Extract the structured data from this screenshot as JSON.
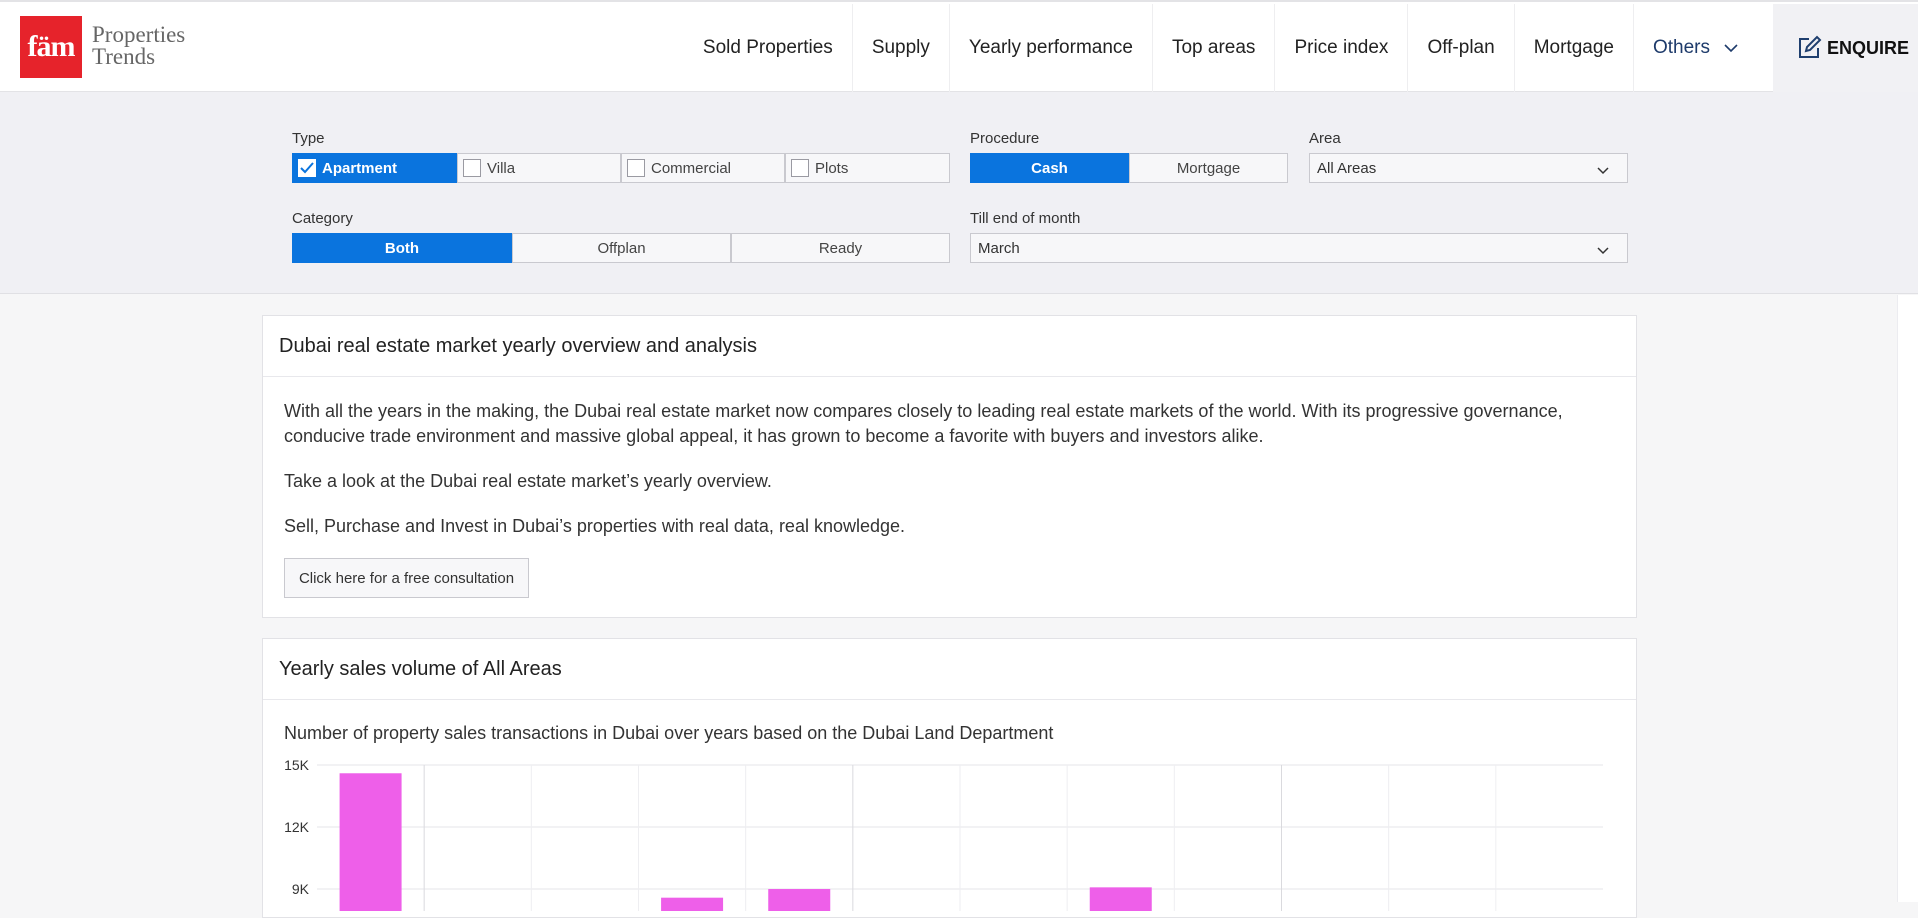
{
  "brand": {
    "logo_mark": "fäm",
    "name_line1": "Properties",
    "name_line2": "Trends",
    "logo_color": "#e6232b"
  },
  "nav": {
    "items": [
      "Sold Properties",
      "Supply",
      "Yearly performance",
      "Top areas",
      "Price index",
      "Off-plan",
      "Mortgage"
    ],
    "others_label": "Others",
    "enquire_label": "ENQUIRE"
  },
  "filters": {
    "type_label": "Type",
    "type_options": [
      "Apartment",
      "Villa",
      "Commercial",
      "Plots"
    ],
    "type_selected": "Apartment",
    "procedure_label": "Procedure",
    "procedure_options": [
      "Cash",
      "Mortgage"
    ],
    "procedure_selected": "Cash",
    "area_label": "Area",
    "area_value": "All Areas",
    "category_label": "Category",
    "category_options": [
      "Both",
      "Offplan",
      "Ready"
    ],
    "category_selected": "Both",
    "month_label": "Till end of month",
    "month_value": "March",
    "accent_color": "#0a74de"
  },
  "overview": {
    "title": "Dubai real estate market yearly overview and analysis",
    "para1": "With all the years in the making, the Dubai real estate market now compares closely to leading real estate markets of the world. With its progressive governance, conducive trade environment and massive global appeal, it has grown to become a favorite with buyers and investors alike.",
    "para2": "Take a look at the Dubai real estate market’s yearly overview.",
    "para3": "Sell, Purchase and Invest in Dubai’s properties with real data, real knowledge.",
    "consult_label": "Click here for a free consultation"
  },
  "sales": {
    "title": "Yearly sales volume of All Areas",
    "caption": "Number of property sales transactions in Dubai over years based on the Dubai Land Department"
  },
  "chart_data": {
    "type": "bar",
    "y_tick_labels": [
      "15K",
      "12K",
      "9K"
    ],
    "y_ticks": [
      15000,
      12000,
      9000
    ],
    "ylim_visible": [
      8400,
      15000
    ],
    "bar_color": "#ee5fe9",
    "categories": [
      "",
      "",
      "",
      "",
      "",
      "",
      "",
      "",
      "",
      "",
      "",
      ""
    ],
    "values": [
      14600,
      null,
      null,
      8580,
      9000,
      null,
      null,
      9080,
      null,
      null,
      null,
      null
    ]
  }
}
